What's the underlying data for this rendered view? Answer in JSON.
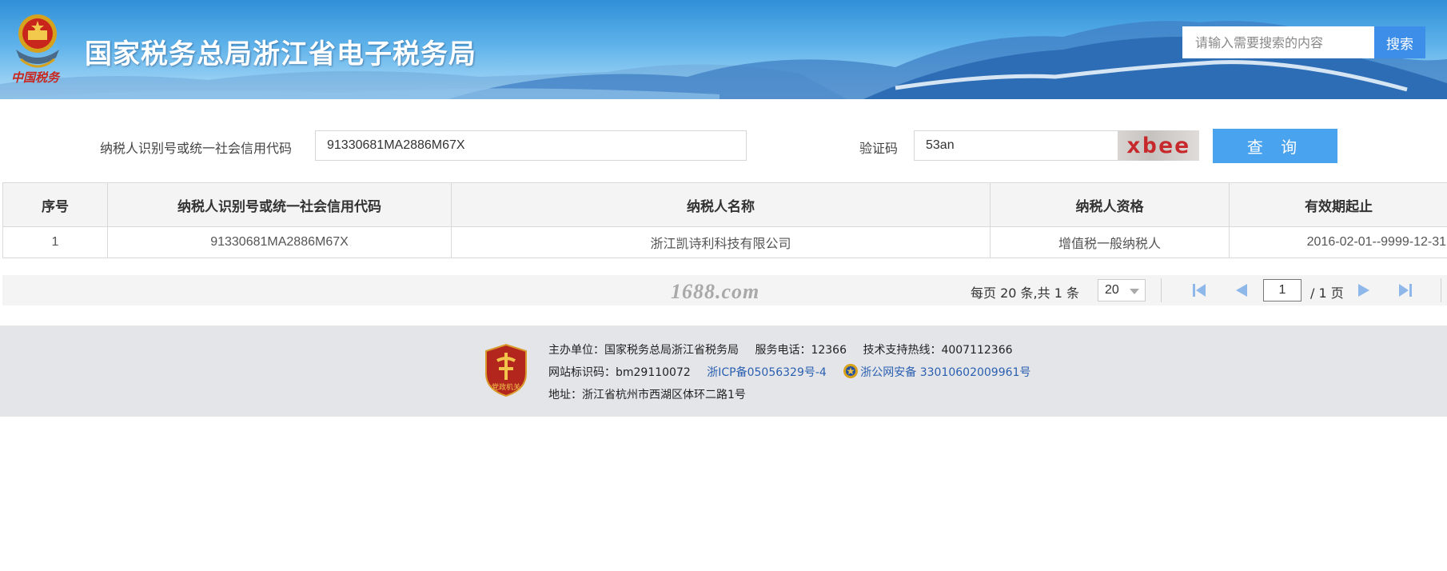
{
  "header": {
    "site_title": "国家税务总局浙江省电子税务局",
    "emblem_caption": "中国税务",
    "search_placeholder": "请输入需要搜索的内容",
    "search_button": "搜索",
    "colors": {
      "sky": "#5eb2ea",
      "search_button": "#3d8ee8"
    }
  },
  "form": {
    "taxpayer_id_label": "纳税人识别号或统一社会信用代码",
    "taxpayer_id_value": "91330681MA2886M67X",
    "captcha_label": "验证码",
    "captcha_value": "53an",
    "captcha_image_text": "xbee",
    "query_button": "查 询",
    "colors": {
      "query_button": "#4aa3ee"
    }
  },
  "table": {
    "columns": [
      "序号",
      "纳税人识别号或统一社会信用代码",
      "纳税人名称",
      "纳税人资格",
      "有效期起止"
    ],
    "rows": [
      [
        "1",
        "91330681MA2886M67X",
        "浙江凯诗利科技有限公司",
        "增值税一般纳税人",
        "2016-02-01--9999-12-31"
      ]
    ]
  },
  "pager": {
    "watermark": "1688.com",
    "summary": "每页 20 条,共 1 条",
    "page_size": "20",
    "current_page": "1",
    "total_pages": "/ 1 页",
    "icons": [
      "first-page-icon",
      "prev-page-icon",
      "next-page-icon",
      "last-page-icon"
    ],
    "colors": {
      "icon": "#8fb8ea"
    }
  },
  "footer": {
    "badge_caption": "党政机关",
    "host": "主办单位：国家税务总局浙江省税务局",
    "service_phone": "服务电话：12366",
    "support_hotline": "技术支持热线：4007112366",
    "site_code": "网站标识码：bm29110072",
    "icp": "浙ICP备05056329号-4",
    "police_record": "浙公网安备 33010602009961号",
    "address": "地址：浙江省杭州市西湖区体环二路1号",
    "colors": {
      "background": "#e4e5e9",
      "link": "#2a5fb0",
      "badge": "#b3261e"
    }
  }
}
